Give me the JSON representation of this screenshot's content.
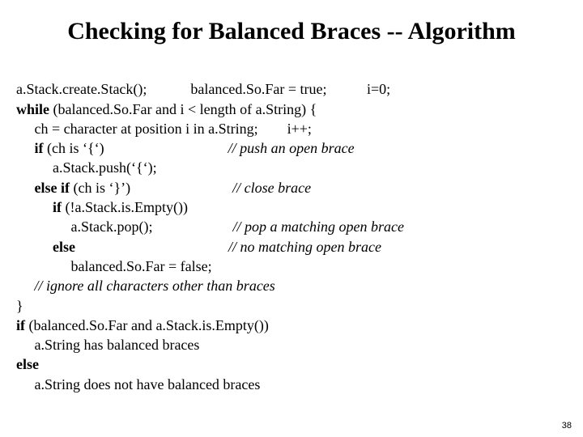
{
  "title": "Checking for Balanced Braces -- Algorithm",
  "lines": {
    "l1a": "a.Stack.create.Stack();            balanced.So.Far = true;           i=0;",
    "l2a": "while",
    "l2b": " (balanced.So.Far and i < length of a.String) {",
    "l3": "     ch = character at position i in a.String;        i++;",
    "l4a": "     if",
    "l4b": " (ch is ‘{‘)                                  ",
    "l4c": "// push an open brace",
    "l5": "          a.Stack.push(‘{‘);",
    "l6a": "     else if",
    "l6b": " (ch is ‘}’)                            ",
    "l6c": "// close brace",
    "l7a": "          if",
    "l7b": " (!a.Stack.is.Empty())",
    "l8a": "               a.Stack.pop();                      ",
    "l8b": "// pop a matching open brace",
    "l9a": "          else                                          ",
    "l9b": "// no matching open brace",
    "l10": "               balanced.So.Far = false;",
    "l11": "     // ignore all characters other than braces",
    "l12": "}",
    "l13a": "if",
    "l13b": " (balanced.So.Far and a.Stack.is.Empty())",
    "l14": "     a.String has balanced braces",
    "l15": "else",
    "l16": "     a.String does not have balanced braces"
  },
  "page_number": "38"
}
